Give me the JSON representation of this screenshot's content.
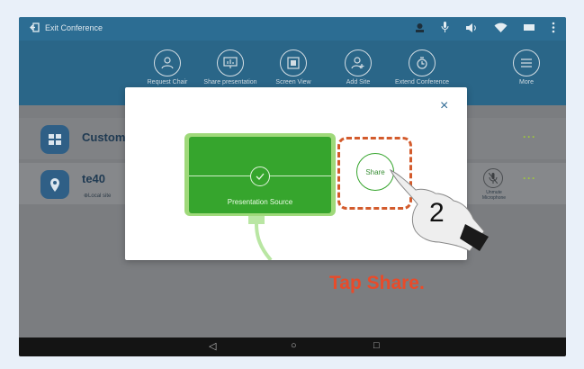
{
  "statusbar": {
    "exit_label": "Exit Conference",
    "icons": [
      "person-icon",
      "mic-icon",
      "speaker-icon",
      "wifi-icon",
      "battery-icon",
      "more-vertical-icon"
    ]
  },
  "toolbar": {
    "items": [
      {
        "label": "Request Chair",
        "icon": "request-chair-icon"
      },
      {
        "label": "Share presentation",
        "icon": "presentation-icon"
      },
      {
        "label": "Screen View",
        "icon": "screen-view-icon"
      },
      {
        "label": "Add Site",
        "icon": "add-site-icon"
      },
      {
        "label": "Extend Conference",
        "icon": "extend-conference-icon"
      },
      {
        "label": "More",
        "icon": "menu-icon"
      }
    ]
  },
  "rows": [
    {
      "title": "Custom",
      "icon": "grid-icon"
    },
    {
      "title": "te40",
      "subtitle": "Local site",
      "icon": "location-pin-icon",
      "mic_label": "Unmute Microphone"
    }
  ],
  "dialog": {
    "close": "×",
    "source_label": "Presentation Source",
    "share_label": "Share"
  },
  "annotation": {
    "step_number": "2",
    "instruction": "Tap Share."
  },
  "navbar": {
    "back": "◁",
    "home": "○",
    "recent": "□"
  },
  "colors": {
    "statusbar": "#2c6d93",
    "toolbar": "#2a6688",
    "green": "#36a52d",
    "highlight": "#d35b2c",
    "instruction": "#e84b2a"
  }
}
